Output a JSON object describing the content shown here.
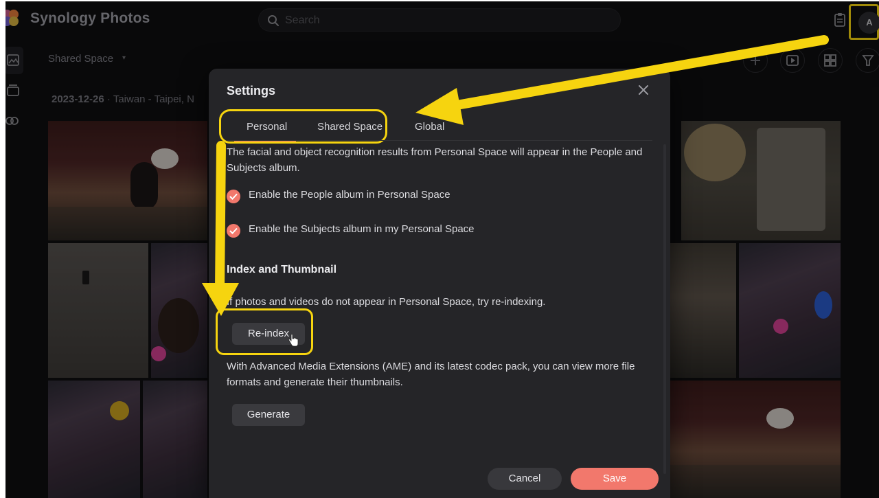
{
  "app": {
    "title": "Synology Photos",
    "search_placeholder": "Search",
    "avatar_initial": "A"
  },
  "library": {
    "space_label": "Shared Space",
    "group_date": "2023-12-26",
    "group_location": "Taiwan - Taipei, N"
  },
  "settings": {
    "title": "Settings",
    "tabs": [
      {
        "label": "Personal",
        "active": true
      },
      {
        "label": "Shared Space",
        "active": false
      },
      {
        "label": "Global",
        "active": false
      }
    ],
    "recognition_desc": "The facial and object recognition results from Personal Space will appear in the People and Subjects album.",
    "options": [
      {
        "label": "Enable the People album in Personal Space",
        "checked": true
      },
      {
        "label": "Enable the Subjects album in my Personal Space",
        "checked": true
      }
    ],
    "index_title": "Index and Thumbnail",
    "index_desc": "If photos and videos do not appear in Personal Space, try re-indexing.",
    "reindex_label": "Re-index",
    "ame_desc": "With Advanced Media Extensions (AME) and its latest codec pack, you can view more file formats and generate their thumbnails.",
    "generate_label": "Generate",
    "cancel_label": "Cancel",
    "save_label": "Save"
  },
  "colors": {
    "accent": "#f2786c",
    "annotation": "#f6d40f",
    "modal_bg": "#252528",
    "app_bg": "#0f0f10"
  },
  "icons": [
    "app-logo-icon",
    "search-icon",
    "clipboard-icon",
    "close-icon",
    "checkmark-icon",
    "hand-cursor-icon",
    "photos-icon",
    "albums-icon",
    "shared-icon",
    "add-icon",
    "slideshow-icon",
    "grid-view-icon",
    "filter-icon"
  ]
}
